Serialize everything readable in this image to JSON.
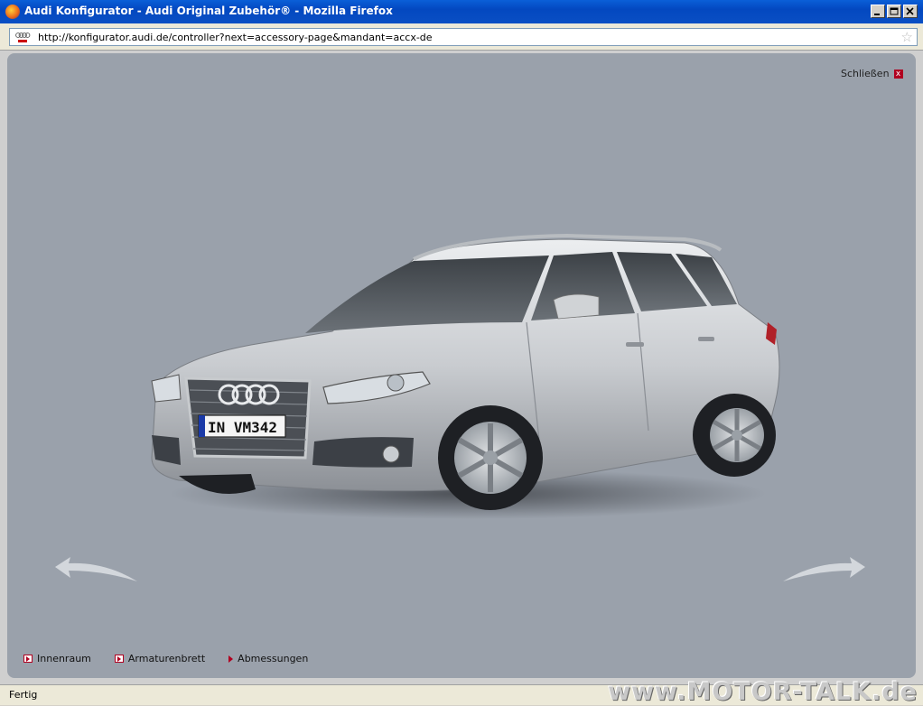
{
  "window": {
    "title": "Audi Konfigurator - Audi Original Zubehör® - Mozilla Firefox"
  },
  "browser": {
    "url": "http://konfigurator.audi.de/controller?next=accessory-page&mandant=accx-de",
    "status": "Fertig"
  },
  "page": {
    "close_label": "Schließen",
    "close_icon_glyph": "x",
    "license_plate": "IN VM342",
    "nav": [
      {
        "label": "Innenraum"
      },
      {
        "label": "Armaturenbrett"
      },
      {
        "label": "Abmessungen"
      }
    ]
  },
  "watermark": "www.MOTOR-TALK.de",
  "colors": {
    "stage_bg": "#9aa1ab",
    "accent_red": "#b00020",
    "titlebar_blue": "#0a5fd8"
  }
}
